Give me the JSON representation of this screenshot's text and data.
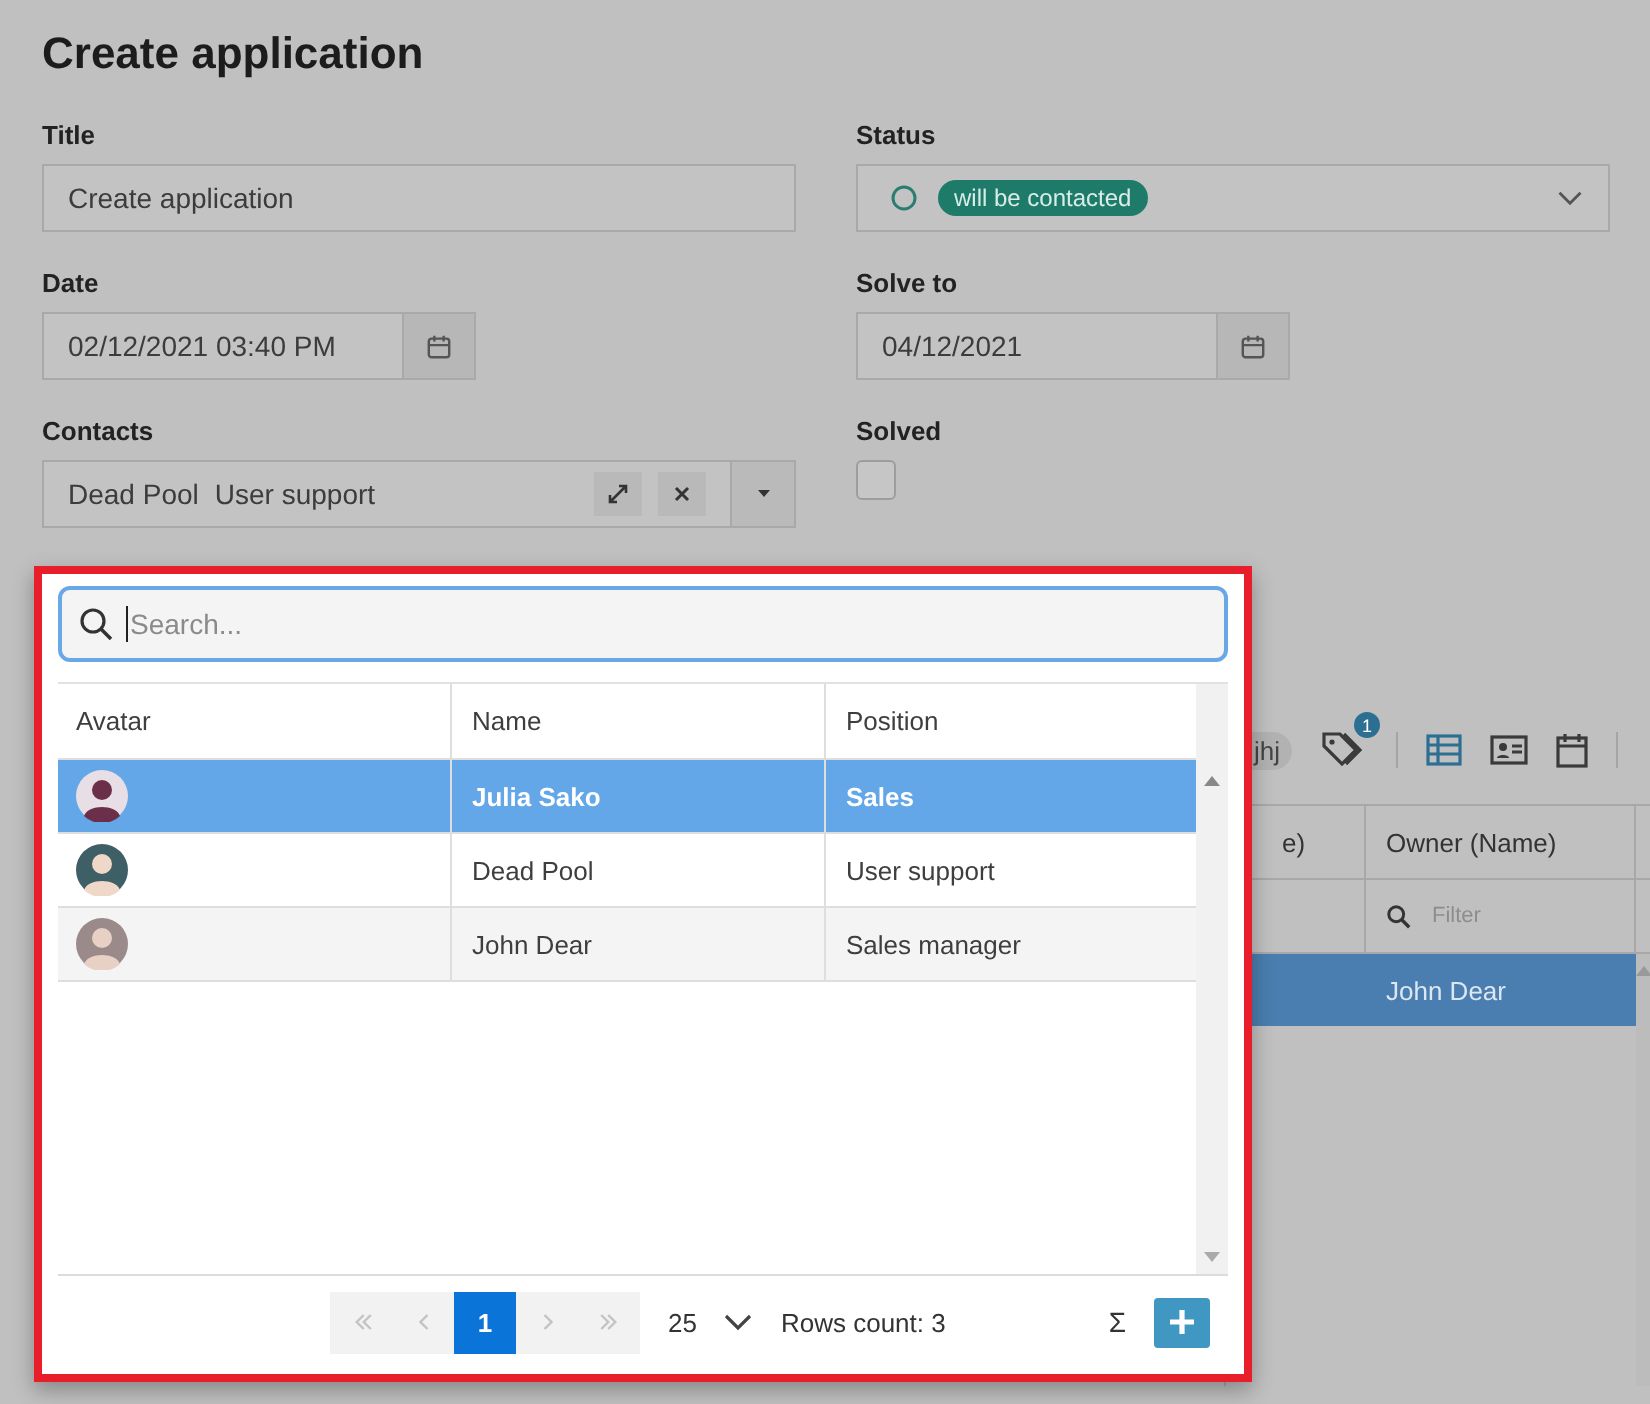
{
  "page": {
    "title": "Create application"
  },
  "fields": [
    {
      "label": "Title",
      "kind": "text",
      "value": "Create application"
    },
    {
      "label": "Status",
      "kind": "status",
      "badge": "will be contacted"
    },
    {
      "label": "Date",
      "kind": "date",
      "value": "02/12/2021 03:40 PM"
    },
    {
      "label": "Solve to",
      "kind": "date",
      "value": "04/12/2021"
    },
    {
      "label": "Contacts",
      "kind": "contacts",
      "values": [
        "Dead Pool",
        "User support"
      ]
    },
    {
      "label": "Solved",
      "kind": "checkbox",
      "checked": false
    }
  ],
  "toolbar": {
    "chip": "jhj",
    "tag_badge": "1"
  },
  "grid": {
    "columns": [
      "e)",
      "Owner (Name)"
    ],
    "filter_placeholder": "Filter",
    "rows": [
      {
        "owner": "John Dear",
        "selected": true
      }
    ]
  },
  "popup": {
    "search": {
      "placeholder": "Search..."
    },
    "columns": [
      "Avatar",
      "Name",
      "Position"
    ],
    "rows": [
      {
        "name": "Julia Sako",
        "position": "Sales",
        "selected": true
      },
      {
        "name": "Dead Pool",
        "position": "User support",
        "selected": false
      },
      {
        "name": "John Dear",
        "position": "Sales manager",
        "selected": false
      }
    ],
    "pager": {
      "nav": [
        {
          "kind": "first",
          "disabled": true
        },
        {
          "kind": "prev",
          "disabled": true
        },
        {
          "kind": "next",
          "disabled": true
        },
        {
          "kind": "last",
          "disabled": true
        }
      ],
      "pages": [
        {
          "label": "1",
          "selected": true
        }
      ],
      "page_size": "25",
      "rows_count": "Rows count: 3",
      "sum": "Σ"
    }
  }
}
